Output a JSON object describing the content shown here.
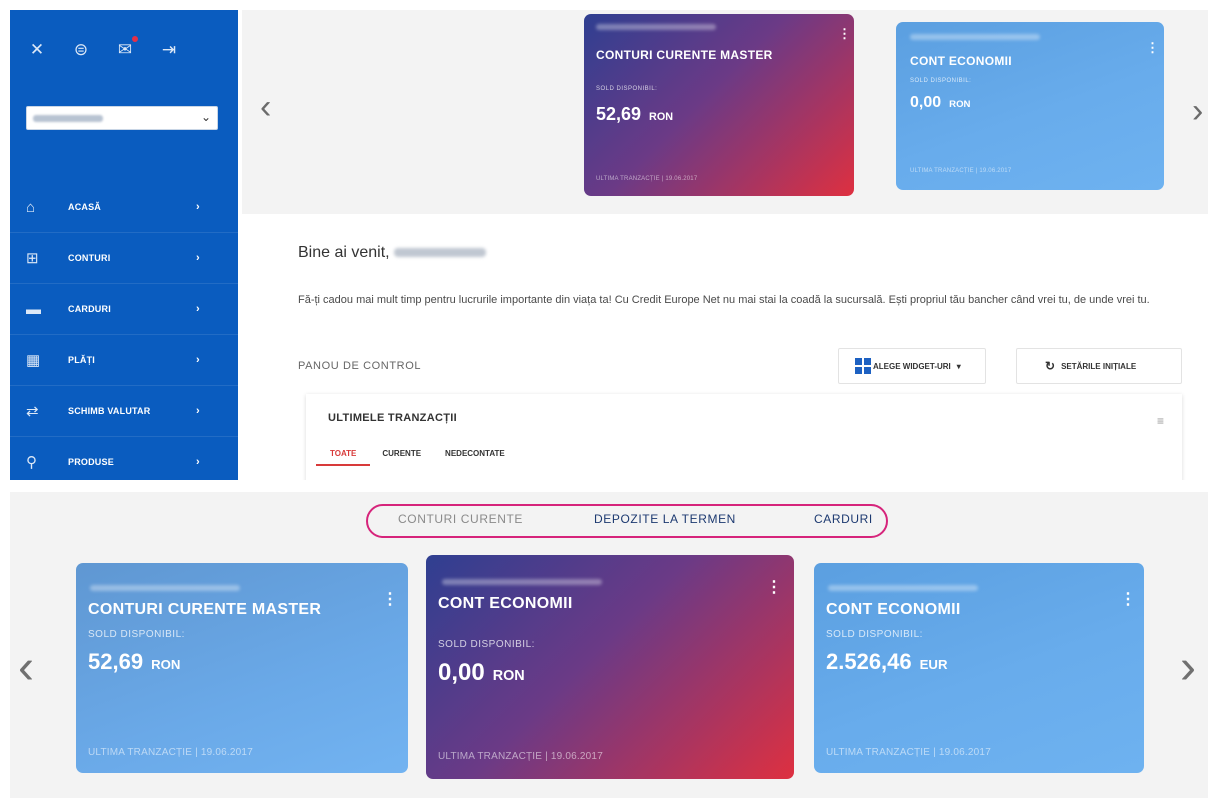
{
  "top": {
    "sidebar": {
      "top_icons": [
        "tools-icon",
        "bag-icon",
        "mail-icon",
        "logout-icon"
      ],
      "select_value": "",
      "items": [
        {
          "icon": "home-icon",
          "label": "ACASĂ",
          "chevron": "›"
        },
        {
          "icon": "accounts-icon",
          "label": "CONTURI",
          "chevron": "›"
        },
        {
          "icon": "card-icon",
          "label": "CARDURI",
          "chevron": "›"
        },
        {
          "icon": "payments-icon",
          "label": "PLĂȚI",
          "chevron": "›"
        },
        {
          "icon": "exchange-icon",
          "label": "SCHIMB VALUTAR",
          "chevron": "›"
        },
        {
          "icon": "products-icon",
          "label": "PRODUSE",
          "chevron": "›"
        }
      ]
    },
    "carousel": {
      "prev": "‹",
      "next": "›",
      "cards": [
        {
          "title": "CONTURI CURENTE MASTER",
          "label": "SOLD DISPONIBIL:",
          "amount": "52,69",
          "currency": "RON",
          "last": "ULTIMA TRANZACȚIE | 19.06.2017",
          "menu": "⋮"
        },
        {
          "title": "CONT ECONOMII",
          "label": "SOLD DISPONIBIL:",
          "amount": "0,00",
          "currency": "RON",
          "last": "ULTIMA TRANZACȚIE | 19.06.2017",
          "menu": "⋮"
        }
      ]
    },
    "welcome": "Bine ai venit,",
    "intro": "Fă-ți cadou mai mult timp pentru lucrurile importante din viața ta! Cu Credit Europe Net nu mai stai la coadă la sucursală. Ești propriul tău bancher când vrei tu, de unde vrei tu.",
    "panel_label": "PANOU DE CONTROL",
    "widgets_button": "ALEGE WIDGET-URI",
    "widgets_caret": "▾",
    "reset_button": "SETĂRILE INIȚIALE",
    "transactions": {
      "title": "ULTIMELE TRANZACȚII",
      "menu": "≡",
      "tabs": [
        "TOATE",
        "CURENTE",
        "NEDECONTATE"
      ]
    }
  },
  "bottom": {
    "tabs": [
      "CONTURI CURENTE",
      "DEPOZITE LA TERMEN",
      "CARDURI"
    ],
    "prev": "‹",
    "next": "›",
    "cards": [
      {
        "title": "CONTURI CURENTE MASTER",
        "label": "SOLD DISPONIBIL:",
        "amount": "52,69",
        "currency": "RON",
        "last": "ULTIMA TRANZACȚIE | 19.06.2017",
        "menu": "⋮"
      },
      {
        "title": "CONT ECONOMII",
        "label": "SOLD DISPONIBIL:",
        "amount": "0,00",
        "currency": "RON",
        "last": "ULTIMA TRANZACȚIE | 19.06.2017",
        "menu": "⋮"
      },
      {
        "title": "CONT ECONOMII",
        "label": "SOLD DISPONIBIL:",
        "amount": "2.526,46",
        "currency": "EUR",
        "last": "ULTIMA TRANZACȚIE | 19.06.2017",
        "menu": "⋮"
      }
    ]
  },
  "colors": {
    "sidebar": "#0a5cbf",
    "card_gradient_start": "#2f3f91",
    "card_gradient_end": "#de3040",
    "card_blue": "#6aa9e8",
    "highlight_outline": "#d6247b",
    "active_tab": "#d83a3a"
  }
}
